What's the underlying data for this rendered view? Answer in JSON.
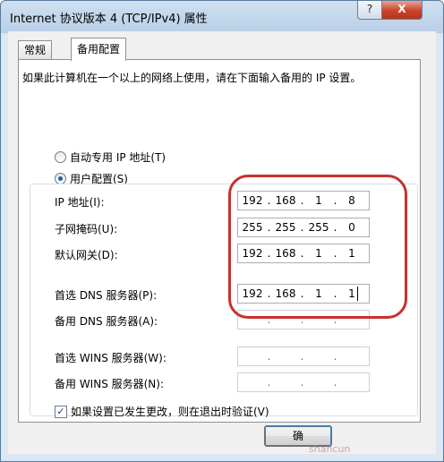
{
  "window": {
    "title": "Internet 协议版本 4 (TCP/IPv4) 属性",
    "help": "?",
    "close": "X"
  },
  "tabs": [
    {
      "label": "常规"
    },
    {
      "label": "备用配置"
    }
  ],
  "intro": "如果此计算机在一个以上的网络上使用，请在下面输入备用的 IP 设置。",
  "radios": {
    "auto": {
      "label": "自动专用 IP 地址(T)",
      "selected": false
    },
    "user": {
      "label": "用户配置(S)",
      "selected": true
    }
  },
  "fields": {
    "ip": {
      "label": "IP 地址(I):",
      "octets": [
        "192",
        "168",
        "1",
        "8"
      ]
    },
    "mask": {
      "label": "子网掩码(U):",
      "octets": [
        "255",
        "255",
        "255",
        "0"
      ]
    },
    "gateway": {
      "label": "默认网关(D):",
      "octets": [
        "192",
        "168",
        "1",
        "1"
      ]
    },
    "dns1": {
      "label": "首选 DNS 服务器(P):",
      "octets": [
        "192",
        "168",
        "1",
        "1"
      ]
    },
    "dns2": {
      "label": "备用 DNS 服务器(A):",
      "octets": [
        "",
        "",
        "",
        ""
      ]
    },
    "wins1": {
      "label": "首选 WINS 服务器(W):",
      "octets": [
        "",
        "",
        "",
        ""
      ]
    },
    "wins2": {
      "label": "备用 WINS 服务器(N):",
      "octets": [
        "",
        "",
        "",
        ""
      ]
    }
  },
  "checkbox": {
    "label": "如果设置已发生更改，则在退出时验证(V)",
    "checked": true
  },
  "buttons": {
    "ok": "确"
  },
  "watermark": "shancun",
  "colors": {
    "highlight": "#c9312c",
    "accent": "#1d5fa8"
  }
}
